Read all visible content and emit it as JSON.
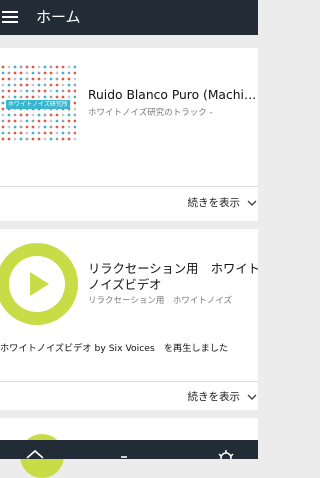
{
  "app_bar": {
    "title": "ホーム",
    "menu_icon": "hamburger-menu-icon"
  },
  "cards": [
    {
      "thumbnail_label": "ホワイトノイズ研究所",
      "title": "Ruido Blanco Puro (Machine...",
      "subtitle": "ホワイトノイズ研究のトラック -",
      "more_label": "続きを表示"
    },
    {
      "title": "リラクセーション用　ホワイトノイズビデオ",
      "subtitle": "リラクセーション用　ホワイトノイズ",
      "activity": "ホワイトノイズビデオ by Six Voices　を再生しました",
      "more_label": "続きを表示"
    }
  ],
  "bottom_nav": [
    "home-icon",
    "minus-icon",
    "settings-gear-icon"
  ],
  "colors": {
    "app_bar": "#222c36",
    "accent_green": "#c8dc47",
    "background": "#ececec"
  }
}
